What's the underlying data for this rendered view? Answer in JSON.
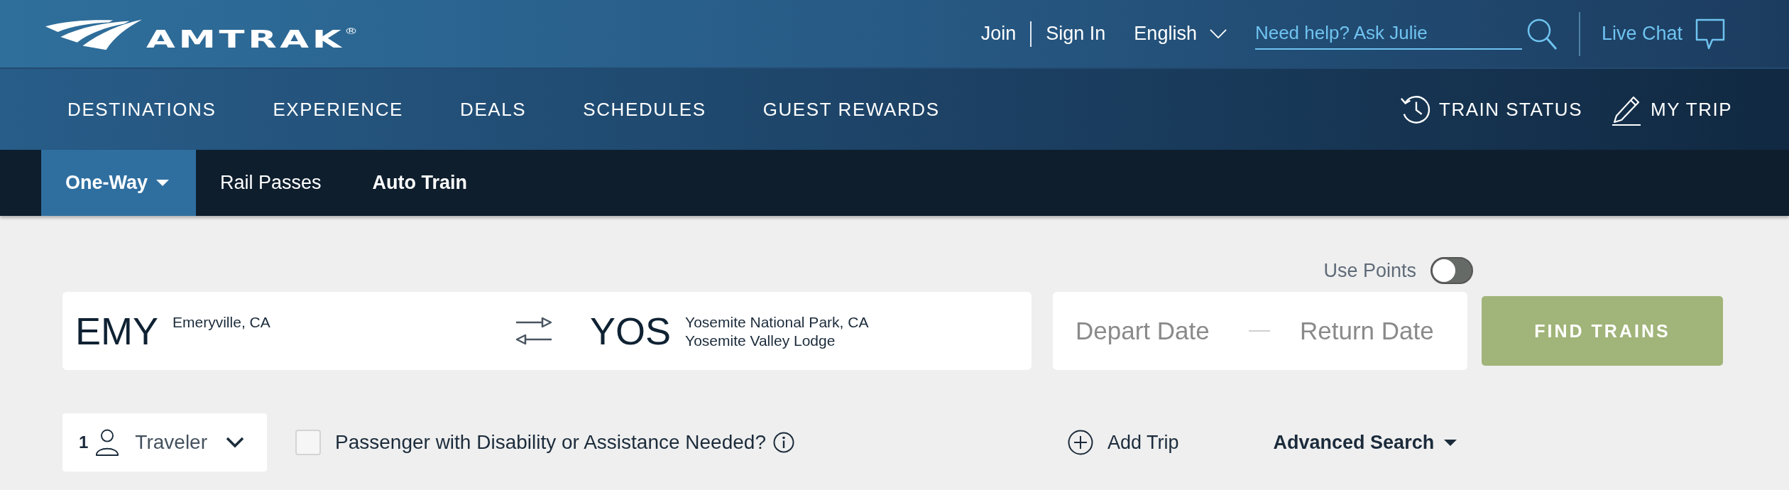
{
  "header": {
    "logo": "AMTRAK$^{®}$",
    "account_links": [
      "Join",
      "Sign In"
    ],
    "language": "English",
    "help_search": {
      "placeholder": "Need help? Ask Julie"
    },
    "live_chat": "Live Chat"
  },
  "main_nav": {
    "items": [
      "DESTINATIONS",
      "EXPERIENCE",
      "DEALS",
      "SCHEDULES",
      "GUEST REWARDS"
    ],
    "actions": [
      {
        "kind": "status",
        "label": "TRAIN STATUS"
      },
      {
        "kind": "trip",
        "label": "MY TRIP"
      }
    ]
  },
  "trip_tabs": [
    {
      "label": "One-Way",
      "selected": true,
      "bold": true,
      "dropdown": true
    },
    {
      "label": "Rail Passes",
      "selected": false,
      "bold": false,
      "dropdown": false
    },
    {
      "label": "Auto Train",
      "selected": false,
      "bold": true,
      "dropdown": false
    }
  ],
  "search": {
    "use_points": {
      "label": "Use Points",
      "on": false
    },
    "origin": {
      "code": "EMY",
      "names": [
        "Emeryville, CA"
      ]
    },
    "destination": {
      "code": "YOS",
      "names": [
        "Yosemite National Park, CA",
        "Yosemite Valley Lodge"
      ]
    },
    "dates": {
      "depart": {
        "placeholder": "Depart Date"
      },
      "return": {
        "placeholder": "Return Date"
      }
    },
    "submit": "FIND TRAINS"
  },
  "options": {
    "travelers": {
      "count": "1",
      "label": "Traveler"
    },
    "assistance": {
      "label": "Passenger with Disability or Assistance Needed?",
      "checked": false
    },
    "add_trip": "Add Trip",
    "advanced_search": "Advanced Search"
  }
}
